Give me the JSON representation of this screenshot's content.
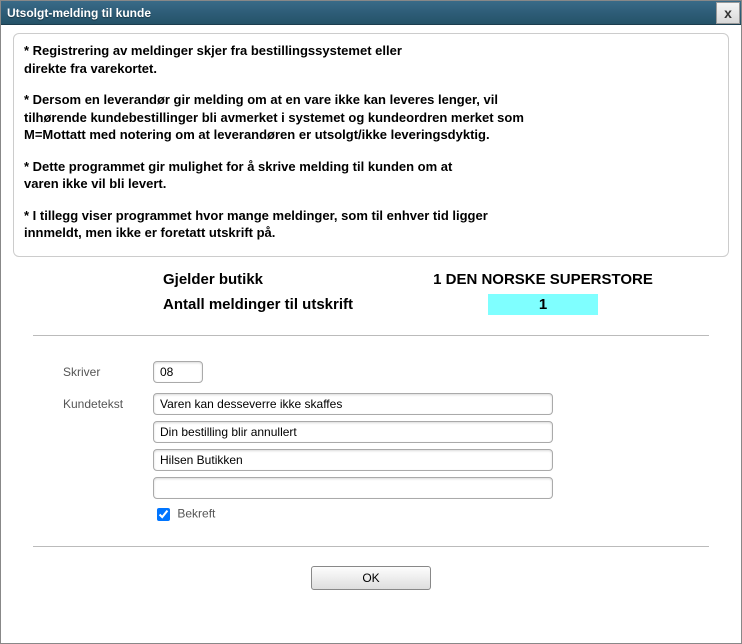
{
  "window": {
    "title": "Utsolgt-melding til kunde",
    "close": "x"
  },
  "info": {
    "p1a": "* Registrering av meldinger skjer fra bestillingssystemet eller",
    "p1b": "  direkte fra varekortet.",
    "p2a": "* Dersom en leverandør gir melding om at en vare ikke kan leveres lenger, vil",
    "p2b": "  tilhørende kundebestillinger bli avmerket i systemet og kundeordren merket som",
    "p2c": "  M=Mottatt med notering om at leverandøren er utsolgt/ikke leveringsdyktig.",
    "p3a": "* Dette programmet gir mulighet for å skrive melding til kunden om at",
    "p3b": "  varen ikke vil bli levert.",
    "p4a": "* I tillegg viser programmet hvor mange meldinger, som til enhver tid ligger",
    "p4b": "  innmeldt, men ikke er foretatt utskrift på."
  },
  "status": {
    "shop_label": "Gjelder butikk",
    "shop_value": "1 DEN NORSKE SUPERSTORE",
    "count_label": "Antall meldinger til utskrift",
    "count_value": "1"
  },
  "form": {
    "printer_label": "Skriver",
    "printer_value": "08",
    "custtext_label": "Kundetekst",
    "line1": "Varen kan desseverre ikke skaffes",
    "line2": "Din bestilling blir annullert",
    "line3": "Hilsen Butikken",
    "line4": "",
    "confirm_label": "Bekreft"
  },
  "buttons": {
    "ok": "OK"
  }
}
